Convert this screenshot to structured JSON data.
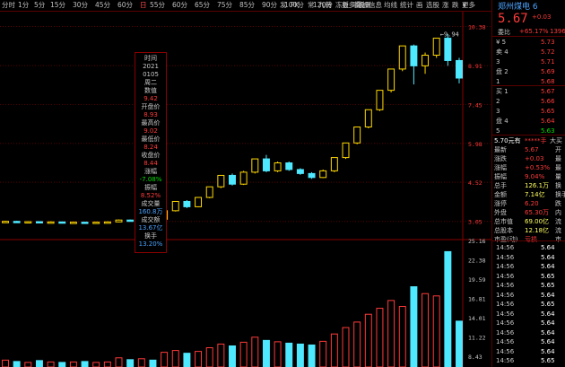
{
  "toolbar": {
    "periods": [
      "分时",
      "1分",
      "5分",
      "15分",
      "30分",
      "45分",
      "60分",
      "日",
      "55分",
      "60分",
      "65分",
      "75分",
      "85分",
      "90分",
      "100分",
      "120分",
      "更多",
      "设置"
    ],
    "tools": [
      "发",
      "PK",
      "常",
      "九转",
      "冻板",
      "事件"
    ],
    "right_tools": [
      "叠加信息",
      "均线",
      "统计",
      "画",
      "选股",
      "涨",
      "跌",
      "更多"
    ]
  },
  "stock": {
    "name": "郑州煤电 6",
    "price": "5.67",
    "change": "+0.03",
    "pct": "+65.17%",
    "volume_tag": "1396"
  },
  "order_book_labels": {
    "wei_bi": "委比",
    "sell": "卖",
    "buy": "买",
    "pan": "盘"
  },
  "sell_orders": [
    {
      "label": "¥ 5",
      "price": "5.73"
    },
    {
      "label": "卖 4",
      "price": "5.72"
    },
    {
      "label": "3",
      "price": "5.71"
    },
    {
      "label": "盘 2",
      "price": "5.69"
    },
    {
      "label": "1",
      "price": "5.68"
    }
  ],
  "buy_orders": [
    {
      "label": "买 1",
      "price": "5.67"
    },
    {
      "label": "2",
      "price": "5.66"
    },
    {
      "label": "3",
      "price": "5.65"
    },
    {
      "label": "盘 4",
      "price": "5.64"
    },
    {
      "label": "5",
      "price": "5.63"
    }
  ],
  "quote_header": {
    "left": "5.70元有",
    "mid": "*****手",
    "right": "大买"
  },
  "quote_rows": [
    {
      "label": "最新",
      "value": "5.67",
      "tail": "开"
    },
    {
      "label": "涨跌",
      "value": "+0.03",
      "tail": "最"
    },
    {
      "label": "涨幅",
      "value": "+0.53%",
      "tail": "最"
    },
    {
      "label": "振幅",
      "value": "9.04%",
      "tail": "量"
    },
    {
      "label": "总手",
      "value": "126.1万",
      "tail": "换"
    },
    {
      "label": "金额",
      "value": "7.14亿",
      "tail": "换手"
    },
    {
      "label": "涨停",
      "value": "6.20",
      "tail": "跌"
    },
    {
      "label": "外盘",
      "value": "65.30万",
      "tail": "内"
    },
    {
      "label": "总市值",
      "value": "69.00亿",
      "tail": "流"
    },
    {
      "label": "总股本",
      "value": "12.18亿",
      "tail": "流"
    },
    {
      "label": "市盈(动)",
      "value": "亏损",
      "tail": "市"
    }
  ],
  "ticks": [
    {
      "time": "14:56",
      "price": "5.64"
    },
    {
      "time": "14:56",
      "price": "5.64"
    },
    {
      "time": "14:56",
      "price": "5.64"
    },
    {
      "time": "14:56",
      "price": "5.65"
    },
    {
      "time": "14:56",
      "price": "5.65"
    },
    {
      "time": "14:56",
      "price": "5.64"
    },
    {
      "time": "14:56",
      "price": "5.65"
    },
    {
      "time": "14:56",
      "price": "5.64"
    },
    {
      "time": "14:56",
      "price": "5.64"
    },
    {
      "time": "14:56",
      "price": "5.64"
    },
    {
      "time": "14:56",
      "price": "5.64"
    },
    {
      "time": "14:56",
      "price": "5.64"
    },
    {
      "time": "14:56",
      "price": "5.65"
    }
  ],
  "info_box": [
    {
      "text": "时间",
      "color": "#c8c8c8"
    },
    {
      "text": "2021",
      "color": "#c8c8c8"
    },
    {
      "text": "0105",
      "color": "#c8c8c8"
    },
    {
      "text": "周二",
      "color": "#c8c8c8"
    },
    {
      "text": "数值",
      "color": "#c8c8c8"
    },
    {
      "text": "9.42",
      "color": "#ff3a3a"
    },
    {
      "text": "开盘价",
      "color": "#c8c8c8"
    },
    {
      "text": "8.93",
      "color": "#ff3a3a"
    },
    {
      "text": "最高价",
      "color": "#c8c8c8"
    },
    {
      "text": "9.02",
      "color": "#ff3a3a"
    },
    {
      "text": "最低价",
      "color": "#c8c8c8"
    },
    {
      "text": "8.24",
      "color": "#ff3a3a"
    },
    {
      "text": "收盘价",
      "color": "#c8c8c8"
    },
    {
      "text": "8.44",
      "color": "#ff3a3a"
    },
    {
      "text": "涨幅",
      "color": "#c8c8c8"
    },
    {
      "text": "-7.08%",
      "color": "#00e000"
    },
    {
      "text": "振幅",
      "color": "#c8c8c8"
    },
    {
      "text": "8.52%",
      "color": "#ff3a3a"
    },
    {
      "text": "成交量",
      "color": "#c8c8c8"
    },
    {
      "text": "160.8万",
      "color": "#4aa3ff"
    },
    {
      "text": "成交额",
      "color": "#c8c8c8"
    },
    {
      "text": "13.67亿",
      "color": "#4aa3ff"
    },
    {
      "text": "换手",
      "color": "#c8c8c8"
    },
    {
      "text": "13.20%",
      "color": "#4aa3ff"
    }
  ],
  "chart_data": {
    "type": "candlestick",
    "price_axis_ticks": [
      "10.38",
      "8.91",
      "7.45",
      "5.98",
      "4.52",
      "3.05"
    ],
    "volume_axis_ticks": [
      "25.16",
      "22.38",
      "19.59",
      "16.81",
      "14.01",
      "11.22",
      "8.43"
    ],
    "peak_label": "9.94",
    "candles": [
      {
        "o": 3.03,
        "c": 3.05,
        "h": 3.07,
        "l": 3.01,
        "v": 1.5
      },
      {
        "o": 3.05,
        "c": 3.02,
        "h": 3.07,
        "l": 3.0,
        "v": 1.2
      },
      {
        "o": 3.02,
        "c": 3.04,
        "h": 3.06,
        "l": 3.0,
        "v": 1.0
      },
      {
        "o": 3.04,
        "c": 3.0,
        "h": 3.05,
        "l": 2.98,
        "v": 1.4
      },
      {
        "o": 3.0,
        "c": 3.03,
        "h": 3.05,
        "l": 2.99,
        "v": 1.1
      },
      {
        "o": 3.03,
        "c": 3.01,
        "h": 3.04,
        "l": 2.99,
        "v": 1.0
      },
      {
        "o": 3.01,
        "c": 3.02,
        "h": 3.04,
        "l": 3.0,
        "v": 1.1
      },
      {
        "o": 3.02,
        "c": 3.0,
        "h": 3.03,
        "l": 2.98,
        "v": 1.2
      },
      {
        "o": 3.0,
        "c": 3.02,
        "h": 3.04,
        "l": 2.99,
        "v": 1.0
      },
      {
        "o": 3.02,
        "c": 3.03,
        "h": 3.05,
        "l": 3.0,
        "v": 1.1
      },
      {
        "o": 3.03,
        "c": 3.1,
        "h": 3.12,
        "l": 3.02,
        "v": 2.0
      },
      {
        "o": 3.1,
        "c": 3.08,
        "h": 3.12,
        "l": 3.06,
        "v": 1.6
      },
      {
        "o": 3.08,
        "c": 3.16,
        "h": 3.18,
        "l": 3.07,
        "v": 1.8
      },
      {
        "o": 3.16,
        "c": 3.13,
        "h": 3.18,
        "l": 3.12,
        "v": 1.5
      },
      {
        "o": 3.13,
        "c": 3.45,
        "h": 3.46,
        "l": 3.12,
        "v": 3.2
      },
      {
        "o": 3.45,
        "c": 3.8,
        "h": 3.8,
        "l": 3.42,
        "v": 3.6
      },
      {
        "o": 3.8,
        "c": 3.6,
        "h": 3.85,
        "l": 3.55,
        "v": 3.0
      },
      {
        "o": 3.6,
        "c": 3.95,
        "h": 3.96,
        "l": 3.58,
        "v": 3.4
      },
      {
        "o": 3.95,
        "c": 4.35,
        "h": 4.35,
        "l": 3.92,
        "v": 4.2
      },
      {
        "o": 4.35,
        "c": 4.78,
        "h": 4.78,
        "l": 4.3,
        "v": 5.0
      },
      {
        "o": 4.78,
        "c": 4.45,
        "h": 4.85,
        "l": 4.4,
        "v": 4.6
      },
      {
        "o": 4.45,
        "c": 4.9,
        "h": 4.95,
        "l": 4.42,
        "v": 5.4
      },
      {
        "o": 4.9,
        "c": 5.4,
        "h": 5.4,
        "l": 4.85,
        "v": 6.5
      },
      {
        "o": 5.4,
        "c": 4.95,
        "h": 5.55,
        "l": 4.9,
        "v": 5.8
      },
      {
        "o": 4.95,
        "c": 5.25,
        "h": 5.3,
        "l": 4.9,
        "v": 5.5
      },
      {
        "o": 5.25,
        "c": 5.0,
        "h": 5.3,
        "l": 4.95,
        "v": 5.2
      },
      {
        "o": 5.0,
        "c": 4.85,
        "h": 5.05,
        "l": 4.8,
        "v": 5.0
      },
      {
        "o": 4.85,
        "c": 4.7,
        "h": 4.9,
        "l": 4.65,
        "v": 4.8
      },
      {
        "o": 4.7,
        "c": 4.95,
        "h": 5.0,
        "l": 4.68,
        "v": 5.6
      },
      {
        "o": 4.95,
        "c": 5.45,
        "h": 5.45,
        "l": 4.9,
        "v": 7.2
      },
      {
        "o": 5.45,
        "c": 6.0,
        "h": 6.0,
        "l": 5.4,
        "v": 8.6
      },
      {
        "o": 6.0,
        "c": 6.6,
        "h": 6.6,
        "l": 5.95,
        "v": 9.8
      },
      {
        "o": 6.6,
        "c": 7.25,
        "h": 7.25,
        "l": 6.55,
        "v": 11.5
      },
      {
        "o": 7.25,
        "c": 7.98,
        "h": 7.98,
        "l": 7.2,
        "v": 12.8
      },
      {
        "o": 7.98,
        "c": 8.78,
        "h": 8.78,
        "l": 7.9,
        "v": 14.5
      },
      {
        "o": 8.78,
        "c": 9.65,
        "h": 9.65,
        "l": 8.7,
        "v": 13.2
      },
      {
        "o": 9.65,
        "c": 8.9,
        "h": 9.7,
        "l": 8.2,
        "v": 17.5
      },
      {
        "o": 8.9,
        "c": 9.3,
        "h": 9.4,
        "l": 8.6,
        "v": 16.0
      },
      {
        "o": 9.3,
        "c": 9.94,
        "h": 9.94,
        "l": 9.2,
        "v": 15.5
      },
      {
        "o": 9.94,
        "c": 9.1,
        "h": 10.1,
        "l": 8.9,
        "v": 25.16
      },
      {
        "o": 9.1,
        "c": 8.44,
        "h": 9.2,
        "l": 8.24,
        "v": 10.0
      }
    ]
  }
}
